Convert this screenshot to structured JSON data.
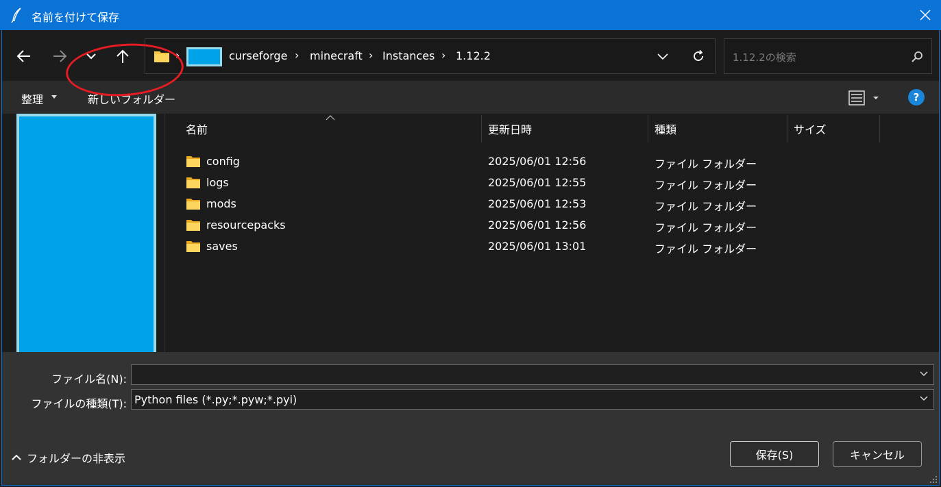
{
  "window": {
    "title": "名前を付けて保存",
    "title_icon": "feather-icon",
    "close_icon": "close-icon"
  },
  "nav": {
    "back_icon": "arrow-left-icon",
    "forward_icon": "arrow-right-icon",
    "recent_icon": "chevron-down-icon",
    "up_icon": "arrow-up-icon"
  },
  "address": {
    "separator": "›",
    "breadcrumbs": [
      "curseforge",
      "minecraft",
      "Instances",
      "1.12.2"
    ],
    "dropdown_icon": "chevron-down-icon",
    "refresh_icon": "refresh-icon"
  },
  "search": {
    "placeholder": "1.12.2の検索",
    "icon": "search-icon"
  },
  "commands": {
    "organize": "整理",
    "new_folder": "新しいフォルダー",
    "view_icon": "details-view-icon",
    "help": "?"
  },
  "columns": {
    "name": "名前",
    "modified": "更新日時",
    "type": "種類",
    "size": "サイズ"
  },
  "files": [
    {
      "name": "config",
      "modified": "2025/06/01 12:56",
      "type": "ファイル フォルダー"
    },
    {
      "name": "logs",
      "modified": "2025/06/01 12:55",
      "type": "ファイル フォルダー"
    },
    {
      "name": "mods",
      "modified": "2025/06/01 12:53",
      "type": "ファイル フォルダー"
    },
    {
      "name": "resourcepacks",
      "modified": "2025/06/01 12:56",
      "type": "ファイル フォルダー"
    },
    {
      "name": "saves",
      "modified": "2025/06/01 13:01",
      "type": "ファイル フォルダー"
    }
  ],
  "form": {
    "filename_label": "ファイル名(N):",
    "filename_value": "",
    "filetype_label": "ファイルの種類(T):",
    "filetype_value": "Python files (*.py;*.pyw;*.pyi)"
  },
  "footer": {
    "hide_folders": "フォルダーの非表示",
    "save": "保存(S)",
    "cancel": "キャンセル"
  },
  "colors": {
    "title_bar": "#0a73d5",
    "redaction": "#00a2e8",
    "annotation": "#e51c23",
    "folder": "#f8c541"
  }
}
